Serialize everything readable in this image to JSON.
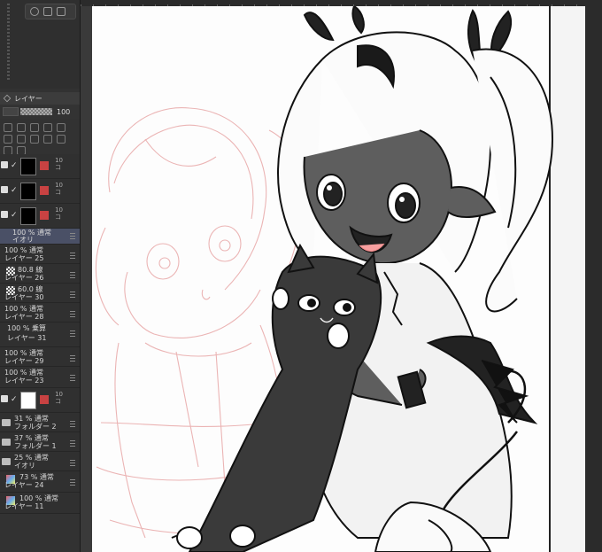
{
  "panel": {
    "title": "レイヤー",
    "opacity": "100"
  },
  "layers": [
    {
      "pct": "10",
      "sub": "コ"
    },
    {
      "pct": "10",
      "sub": "コ"
    },
    {
      "pct": "10",
      "sub": "コ"
    },
    {
      "line1": "100 % 通常",
      "line2": "イオリ"
    },
    {
      "line1": "100 % 通常",
      "line2": "レイヤー 25"
    },
    {
      "line1": "80.8 線",
      "line2": "レイヤー 26"
    },
    {
      "line1": "60.0 線",
      "line2": "レイヤー 30"
    },
    {
      "line1": "100 % 通常",
      "line2": "レイヤー 28"
    },
    {
      "line1": "100 % 乗算",
      "line2": "レイヤー 31"
    },
    {
      "line1": "100 % 通常",
      "line2": "レイヤー 29"
    },
    {
      "line1": "100 % 通常",
      "line2": "レイヤー 23"
    },
    {
      "pct": "10",
      "sub": "コ"
    },
    {
      "line1": "31 % 通常",
      "line2": "フォルダー 2"
    },
    {
      "line1": "37 % 通常",
      "line2": "フォルダー 1"
    },
    {
      "line1": "25 % 通常",
      "line2": "イオリ"
    },
    {
      "line1": "73 % 通常",
      "line2": "レイヤー 24"
    },
    {
      "line1": "100 % 通常",
      "line2": "レイヤー 11"
    }
  ],
  "colors": {
    "panel_bg": "#323232",
    "selected_row": "#4a5066",
    "canvas_bg": "#fdfdfd",
    "sketch": "#e8a8a8"
  }
}
